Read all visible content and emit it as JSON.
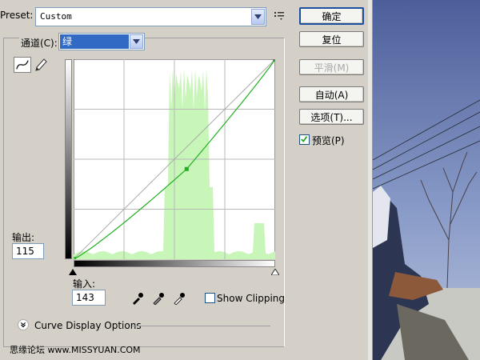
{
  "preset": {
    "label": "Preset:",
    "value": "Custom"
  },
  "channel": {
    "label": "通道(C):",
    "value": "绿"
  },
  "output": {
    "label": "输出:",
    "value": "115"
  },
  "input": {
    "label": "输入:",
    "value": "143"
  },
  "show_clipping": {
    "label": "Show Clipping",
    "checked": false
  },
  "curve_display_options": {
    "label": "Curve Display Options"
  },
  "buttons": {
    "ok": "确定",
    "reset": "复位",
    "smooth": "平滑(M)",
    "auto": "自动(A)",
    "options": "选项(T)...",
    "preview": "预览(P)",
    "preview_checked": true
  },
  "watermark": "思缘论坛   www.MISSYUAN.COM",
  "curve": {
    "points": [
      [
        0,
        0
      ],
      [
        143,
        115
      ],
      [
        255,
        255
      ]
    ],
    "selected_point": [
      143,
      115
    ]
  },
  "histogram_color": "#c8f5b8",
  "curve_color": "#20b020",
  "icons": {
    "preset_menu": "list-menu-icon",
    "curve_tool": "curve-tool-icon",
    "pencil_tool": "pencil-icon",
    "eyedroppers": [
      "black-eyedropper-icon",
      "gray-eyedropper-icon",
      "white-eyedropper-icon"
    ],
    "options_toggle": "chevron-double-down-icon"
  }
}
